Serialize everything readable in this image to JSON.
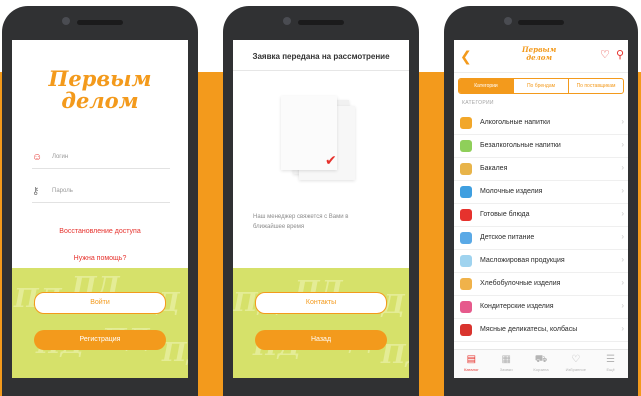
{
  "login": {
    "logo_line1": "Первым",
    "logo_line2": "делом",
    "login_placeholder": "Логин",
    "password_placeholder": "Пароль",
    "restore_access": "Восстановление доступа",
    "need_help": "Нужна помощь?",
    "login_button": "Войти",
    "register_button": "Регистрация",
    "pattern_text": "ПД"
  },
  "request": {
    "title": "Заявка передана на рассмотрение",
    "message": "Наш менеджер свяжется с Вами в ближайшее время",
    "contacts_button": "Контакты",
    "back_button": "Назад"
  },
  "catalog": {
    "logo_line1": "Первым",
    "logo_line2": "делом",
    "segments": [
      "Категории",
      "По брендам",
      "По поставщикам"
    ],
    "section_label": "КАТЕГОРИИ",
    "categories": [
      {
        "label": "Алкогольные напитки",
        "color": "#f2a72a"
      },
      {
        "label": "Безалкогольные напитки",
        "color": "#8fcf5a"
      },
      {
        "label": "Бакалея",
        "color": "#e8b44a"
      },
      {
        "label": "Молочные изделия",
        "color": "#3f9fe0"
      },
      {
        "label": "Готовые блюда",
        "color": "#e6322d"
      },
      {
        "label": "Детское питание",
        "color": "#5aa9e6"
      },
      {
        "label": "Масложировая продукция",
        "color": "#9fd3ef"
      },
      {
        "label": "Хлебобулочные изделия",
        "color": "#f0b24a"
      },
      {
        "label": "Кондитерские изделия",
        "color": "#e65a8c"
      },
      {
        "label": "Мясные деликатесы, колбасы",
        "color": "#d9342e"
      }
    ],
    "tabs": [
      {
        "label": "Каталог",
        "icon": "catalog-icon",
        "glyph": "▤"
      },
      {
        "label": "Заявки",
        "icon": "orders-icon",
        "glyph": "▦"
      },
      {
        "label": "Корзина",
        "icon": "cart-icon",
        "glyph": "⛟"
      },
      {
        "label": "Избранное",
        "icon": "heart-icon",
        "glyph": "♡"
      },
      {
        "label": "Ещё",
        "icon": "more-icon",
        "glyph": "☰"
      }
    ]
  }
}
